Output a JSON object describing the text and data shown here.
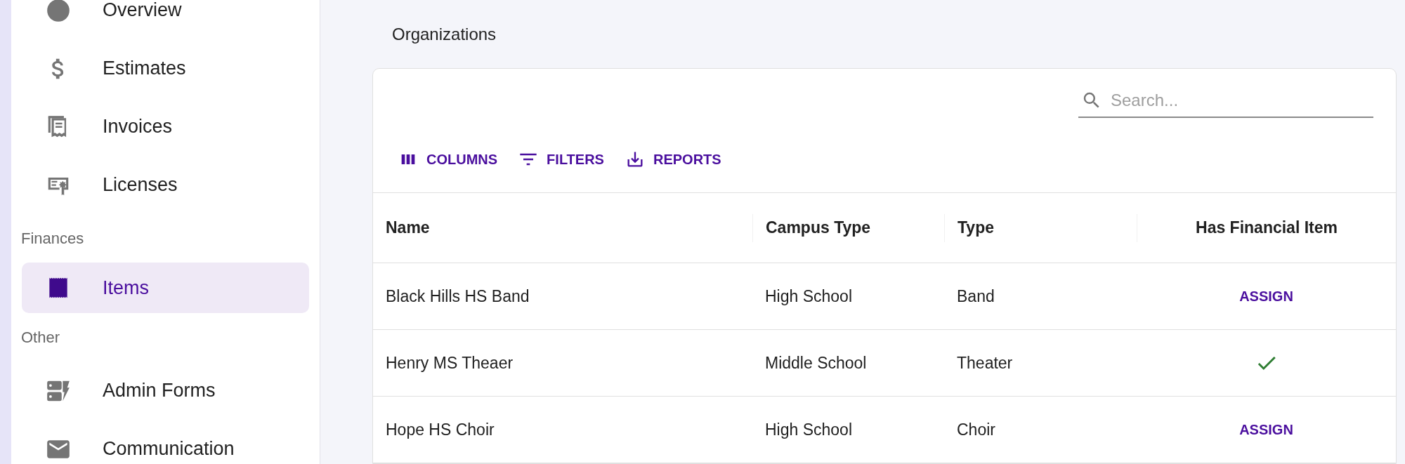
{
  "sidebar": {
    "sections": [
      {
        "items": [
          {
            "label": "Overview",
            "selected": false
          },
          {
            "label": "Estimates",
            "selected": false
          },
          {
            "label": "Invoices",
            "selected": false
          },
          {
            "label": "Licenses",
            "selected": false
          }
        ]
      },
      {
        "title": "Finances",
        "items": [
          {
            "label": "Items",
            "selected": true
          }
        ]
      },
      {
        "title": "Other",
        "items": [
          {
            "label": "Admin Forms",
            "selected": false
          },
          {
            "label": "Communication",
            "selected": false
          }
        ]
      }
    ]
  },
  "page_title": "Organizations",
  "search": {
    "placeholder": "Search..."
  },
  "toolbar": [
    {
      "kind": "columns",
      "label": "COLUMNS"
    },
    {
      "kind": "filters",
      "label": "FILTERS"
    },
    {
      "kind": "reports",
      "label": "REPORTS"
    }
  ],
  "table": {
    "columns": [
      "Name",
      "Campus Type",
      "Type",
      "Has Financial Item"
    ],
    "rows": [
      {
        "name": "Black Hills HS Band",
        "campus_type": "High School",
        "type": "Band",
        "financial_item": {
          "kind": "button",
          "label": "ASSIGN"
        }
      },
      {
        "name": "Henry MS Theaer",
        "campus_type": "Middle School",
        "type": "Theater",
        "financial_item": {
          "kind": "check"
        }
      },
      {
        "name": "Hope HS Choir",
        "campus_type": "High School",
        "type": "Choir",
        "financial_item": {
          "kind": "button",
          "label": "ASSIGN"
        }
      }
    ]
  }
}
